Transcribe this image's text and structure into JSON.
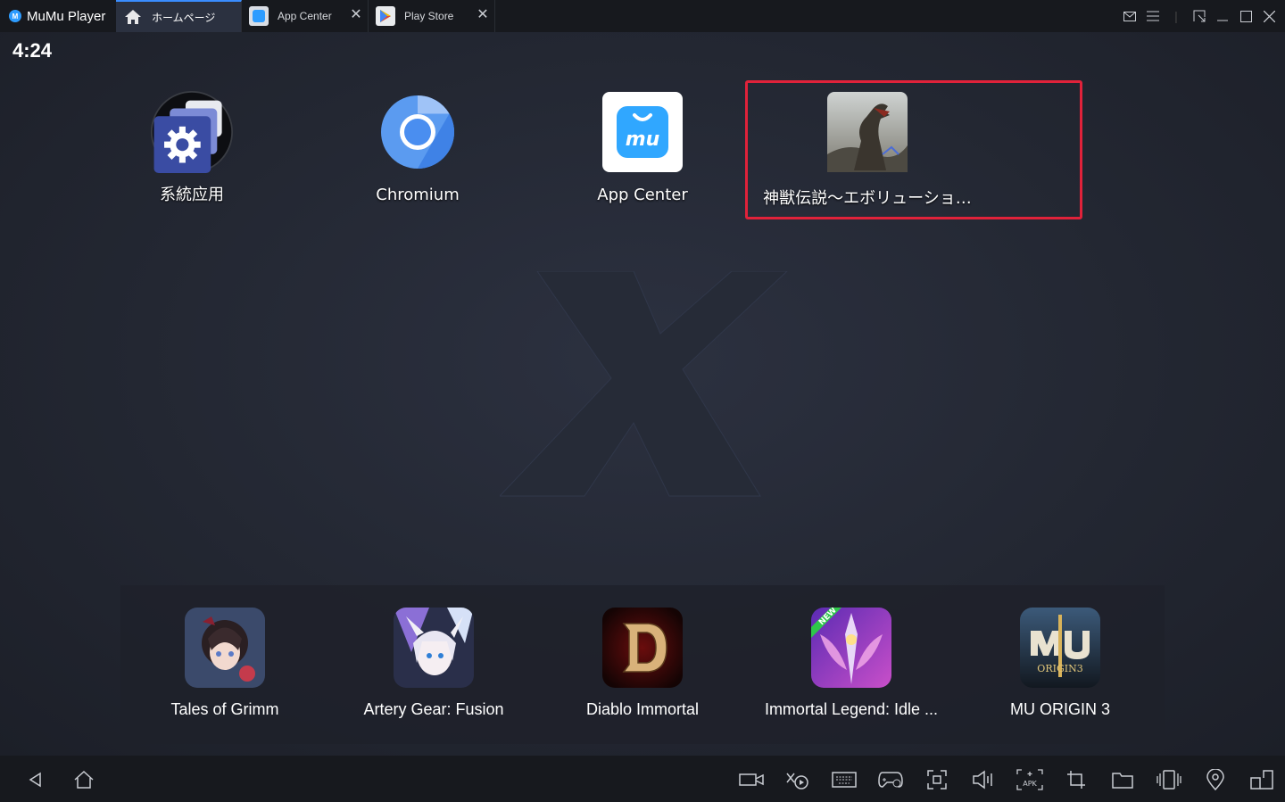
{
  "titlebar": {
    "app_name": "MuMu Player",
    "tabs": [
      {
        "label": "ホームページ",
        "icon": "home-icon",
        "active": true
      },
      {
        "label": "App Center",
        "icon": "app-center-icon",
        "active": false
      },
      {
        "label": "Play Store",
        "icon": "play-store-icon",
        "active": false
      }
    ],
    "window_controls": [
      "mail-icon",
      "menu-icon",
      "resize-icon",
      "minimize-icon",
      "maximize-icon",
      "close-icon"
    ]
  },
  "screen": {
    "clock": "4:24",
    "apps": [
      {
        "label": "系統应用",
        "icon": "settings-icon"
      },
      {
        "label": "Chromium",
        "icon": "chromium-icon"
      },
      {
        "label": "App Center",
        "icon": "app-center-icon"
      },
      {
        "label": "神獣伝説～エボリューショ…",
        "icon": "dinosaur-game-icon"
      }
    ],
    "dock": [
      {
        "label": "Tales of Grimm",
        "icon": "tales-of-grimm-icon"
      },
      {
        "label": "Artery Gear: Fusion",
        "icon": "artery-gear-icon"
      },
      {
        "label": "Diablo Immortal",
        "icon": "diablo-immortal-icon"
      },
      {
        "label": "Immortal Legend: Idle ...",
        "icon": "immortal-legend-icon"
      },
      {
        "label": "MU ORIGIN 3",
        "icon": "mu-origin-icon"
      }
    ]
  },
  "badge_new": "NEW",
  "mu_logo_text": "ORIGIN3",
  "appcenter_logo_text": "mu",
  "apk_text": "APK",
  "navbar": {
    "left": [
      "back-icon",
      "home-icon"
    ],
    "right": [
      "video-record-icon",
      "macro-icon",
      "keyboard-icon",
      "gamepad-icon",
      "screenshot-icon",
      "volume-icon",
      "apk-install-icon",
      "crop-icon",
      "folder-icon",
      "shake-icon",
      "location-icon",
      "multi-window-icon"
    ]
  },
  "colors": {
    "highlight": "#e0223a",
    "accent": "#3a8dff"
  }
}
